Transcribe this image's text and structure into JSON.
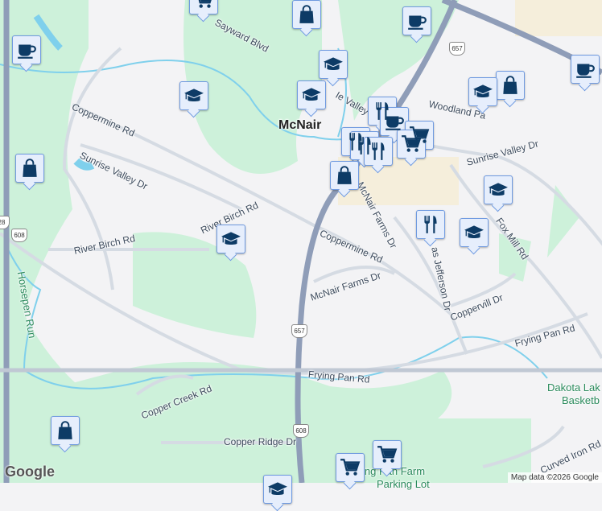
{
  "map": {
    "place_title": "McNair",
    "roads": [
      "Sayward Blvd",
      "Coppermine Rd",
      "Sunrise Valley Dr",
      "River Birch Rd",
      "River Birch Rd",
      "Sunrise Valley Dr",
      "Woodland Pa",
      "Fox Mill Rd",
      "Coppermine Rd",
      "McNair Farms Dr",
      "McNair Farms Dr",
      "as Jefferson Dr",
      "Coppervill Dr",
      "Frying Pan Rd",
      "Frying Pan Rd",
      "Copper Creek Rd",
      "Copper Ridge Dr",
      "Curved Iron Rd",
      "Ie Valley"
    ],
    "water": [
      "Horsepen Run"
    ],
    "pois": [
      "Dakota Lak",
      "Basketb",
      "ing Pan Farm",
      "Parking Lot"
    ],
    "route_shields": [
      "657",
      "657",
      "608",
      "608",
      "28"
    ],
    "marker_types": [
      "cart",
      "bag",
      "coffee",
      "coffee",
      "grad",
      "grad",
      "grad",
      "fork",
      "coffee",
      "bag",
      "grad",
      "coffee",
      "fork",
      "cart",
      "fork",
      "cart",
      "fork",
      "bag",
      "bag",
      "grad",
      "fork",
      "grad",
      "grad",
      "bag",
      "cart",
      "cart",
      "grad"
    ]
  },
  "footer": {
    "attribution": "Map data ©2026 Google",
    "logo": "Google"
  },
  "colors": {
    "marker_fill": "#e6eefc",
    "marker_border": "#6f9ae0",
    "icon": "#0d3b66",
    "park": "#cdf1da",
    "highway": "#8f9db8"
  }
}
